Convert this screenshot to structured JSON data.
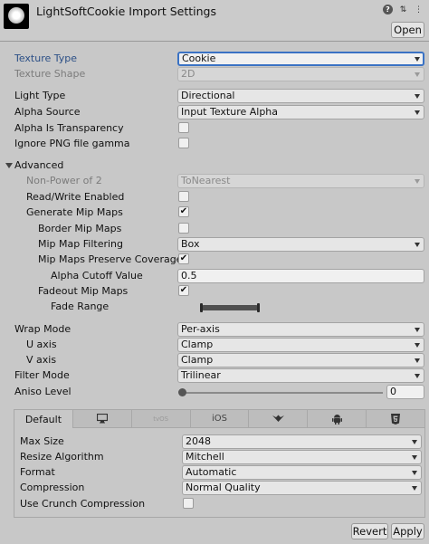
{
  "header": {
    "title": "LightSoftCookie Import Settings",
    "open_label": "Open",
    "icons": [
      "help-icon",
      "preset-icon",
      "menu-icon"
    ]
  },
  "fields": {
    "texture_type": {
      "label": "Texture Type",
      "value": "Cookie"
    },
    "texture_shape": {
      "label": "Texture Shape",
      "value": "2D"
    },
    "light_type": {
      "label": "Light Type",
      "value": "Directional"
    },
    "alpha_source": {
      "label": "Alpha Source",
      "value": "Input Texture Alpha"
    },
    "alpha_is_transparency": {
      "label": "Alpha Is Transparency",
      "checked": false
    },
    "ignore_png_gamma": {
      "label": "Ignore PNG file gamma",
      "checked": false
    }
  },
  "advanced": {
    "label": "Advanced",
    "non_power_of_2": {
      "label": "Non-Power of 2",
      "value": "ToNearest"
    },
    "read_write": {
      "label": "Read/Write Enabled",
      "checked": false
    },
    "generate_mip_maps": {
      "label": "Generate Mip Maps",
      "checked": true,
      "check": "✔"
    },
    "border_mip_maps": {
      "label": "Border Mip Maps",
      "checked": false
    },
    "mip_map_filtering": {
      "label": "Mip Map Filtering",
      "value": "Box"
    },
    "mip_maps_preserve_coverage": {
      "label": "Mip Maps Preserve Coverage",
      "checked": true,
      "check": "✔"
    },
    "alpha_cutoff_value": {
      "label": "Alpha Cutoff Value",
      "value": "0.5"
    },
    "fadeout_mip_maps": {
      "label": "Fadeout Mip Maps",
      "checked": true,
      "check": "✔"
    },
    "fade_range": {
      "label": "Fade Range"
    }
  },
  "wrap": {
    "wrap_mode": {
      "label": "Wrap Mode",
      "value": "Per-axis"
    },
    "u_axis": {
      "label": "U axis",
      "value": "Clamp"
    },
    "v_axis": {
      "label": "V axis",
      "value": "Clamp"
    },
    "filter_mode": {
      "label": "Filter Mode",
      "value": "Trilinear"
    },
    "aniso_level": {
      "label": "Aniso Level",
      "value": "0",
      "level_fraction": 0
    }
  },
  "platform": {
    "tabs": [
      {
        "label": "Default",
        "icon": null
      },
      {
        "label": "",
        "icon": "monitor-icon"
      },
      {
        "label": "tvOS",
        "icon": null
      },
      {
        "label": "iOS",
        "icon": null
      },
      {
        "label": "",
        "icon": "webgl-icon"
      },
      {
        "label": "",
        "icon": "android-icon"
      },
      {
        "label": "",
        "icon": "html5-icon"
      }
    ],
    "max_size": {
      "label": "Max Size",
      "value": "2048"
    },
    "resize_algorithm": {
      "label": "Resize Algorithm",
      "value": "Mitchell"
    },
    "format": {
      "label": "Format",
      "value": "Automatic"
    },
    "compression": {
      "label": "Compression",
      "value": "Normal Quality"
    },
    "use_crunch": {
      "label": "Use Crunch Compression",
      "checked": false
    }
  },
  "footer": {
    "revert_label": "Revert",
    "apply_label": "Apply"
  }
}
